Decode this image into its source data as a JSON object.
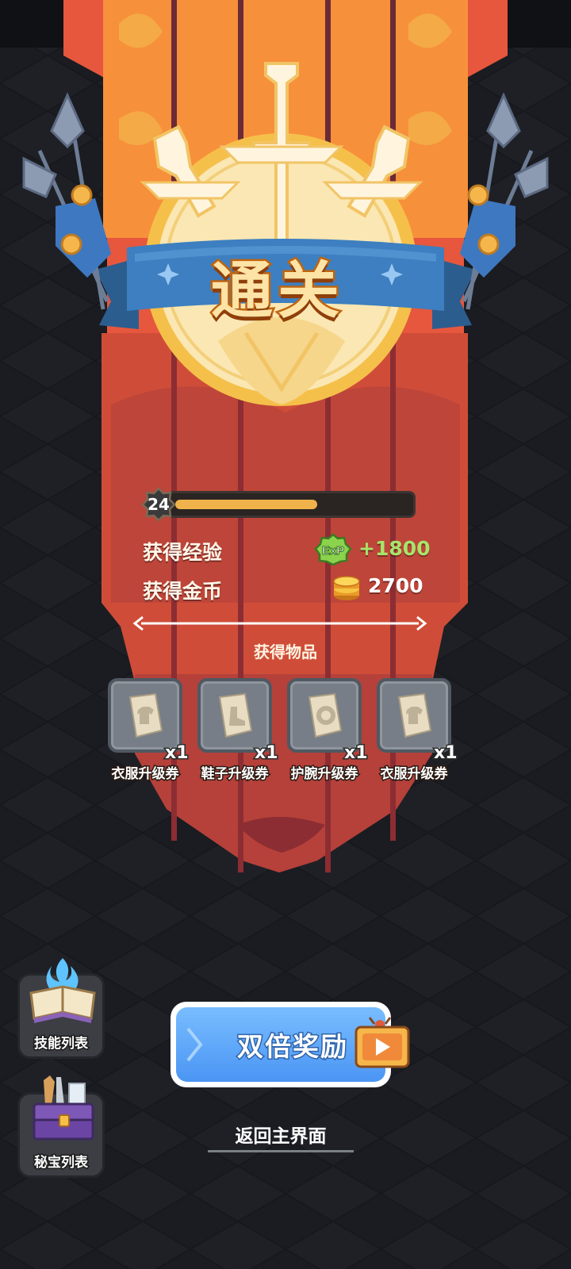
{
  "title": "通关",
  "level": {
    "value": "24",
    "progress": 0.6
  },
  "rewards": {
    "exp_label": "获得经验",
    "exp_icon_text": "ExP",
    "exp_value": "+1800",
    "gold_label": "获得金币",
    "gold_value": "2700"
  },
  "items_title": "获得物品",
  "items": [
    {
      "name": "衣服升级券",
      "qty": "x1",
      "icon": "clothes-coupon-icon"
    },
    {
      "name": "鞋子升级券",
      "qty": "x1",
      "icon": "shoes-coupon-icon"
    },
    {
      "name": "护腕升级券",
      "qty": "x1",
      "icon": "bracer-coupon-icon"
    },
    {
      "name": "衣服升级券",
      "qty": "x1",
      "icon": "clothes-coupon-icon"
    }
  ],
  "side_buttons": {
    "skills": "技能列表",
    "treasures": "秘宝列表"
  },
  "double_reward": "双倍奖励",
  "return_label": "返回主界面",
  "colors": {
    "banner_red": "#e0523d",
    "banner_orange": "#f7903b",
    "ribbon_blue": "#3c7dbd",
    "exp_green": "#9be05a",
    "bar_fill": "#f0b24a",
    "button_blue": "#5aa5f8"
  }
}
